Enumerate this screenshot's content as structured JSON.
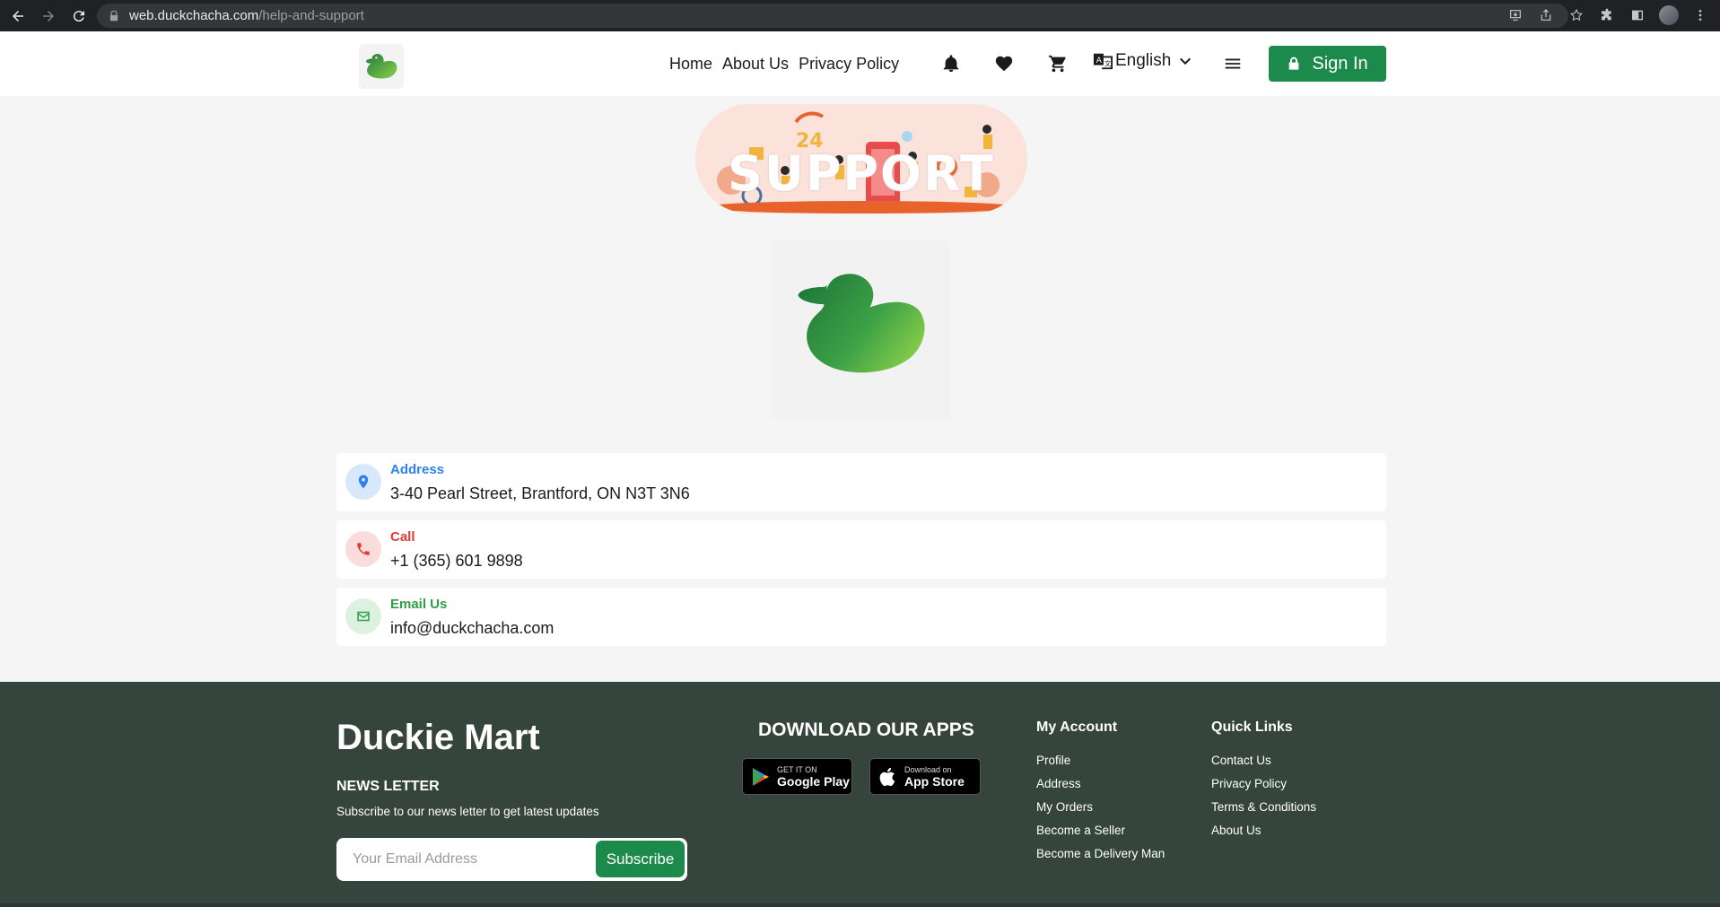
{
  "browser": {
    "url_host": "web.duckchacha.com",
    "url_path": "/help-and-support"
  },
  "header": {
    "nav": [
      "Home",
      "About Us",
      "Privacy Policy"
    ],
    "language": "English",
    "sign_in_label": "Sign In"
  },
  "hero": {
    "banner_text": "SUPPORT"
  },
  "contacts": [
    {
      "title": "Address",
      "value": "3-40 Pearl Street, Brantford, ON N3T 3N6",
      "color": "#2f80ed",
      "bg": "#d8e8fb"
    },
    {
      "title": "Call",
      "value": "+1 (365) 601 9898",
      "color": "#e53935",
      "bg": "#fbdcdc"
    },
    {
      "title": "Email Us",
      "value": "info@duckchacha.com",
      "color": "#2e9e48",
      "bg": "#dcf2e0"
    }
  ],
  "footer": {
    "brand": "Duckie Mart",
    "newsletter_title": "NEWS LETTER",
    "newsletter_desc": "Subscribe to our news letter to get latest updates",
    "email_placeholder": "Your Email Address",
    "subscribe_label": "Subscribe",
    "download_title": "DOWNLOAD OUR APPS",
    "google_play": {
      "small": "GET IT ON",
      "big": "Google Play"
    },
    "app_store": {
      "small": "Download on",
      "big": "App Store"
    },
    "my_account": {
      "title": "My Account",
      "links": [
        "Profile",
        "Address",
        "My Orders",
        "Become a Seller",
        "Become a Delivery Man"
      ]
    },
    "quick_links": {
      "title": "Quick Links",
      "links": [
        "Contact Us",
        "Privacy Policy",
        "Terms & Conditions",
        "About Us"
      ]
    }
  },
  "colors": {
    "primary": "#1b8a4b",
    "footer_bg": "#35443c"
  }
}
